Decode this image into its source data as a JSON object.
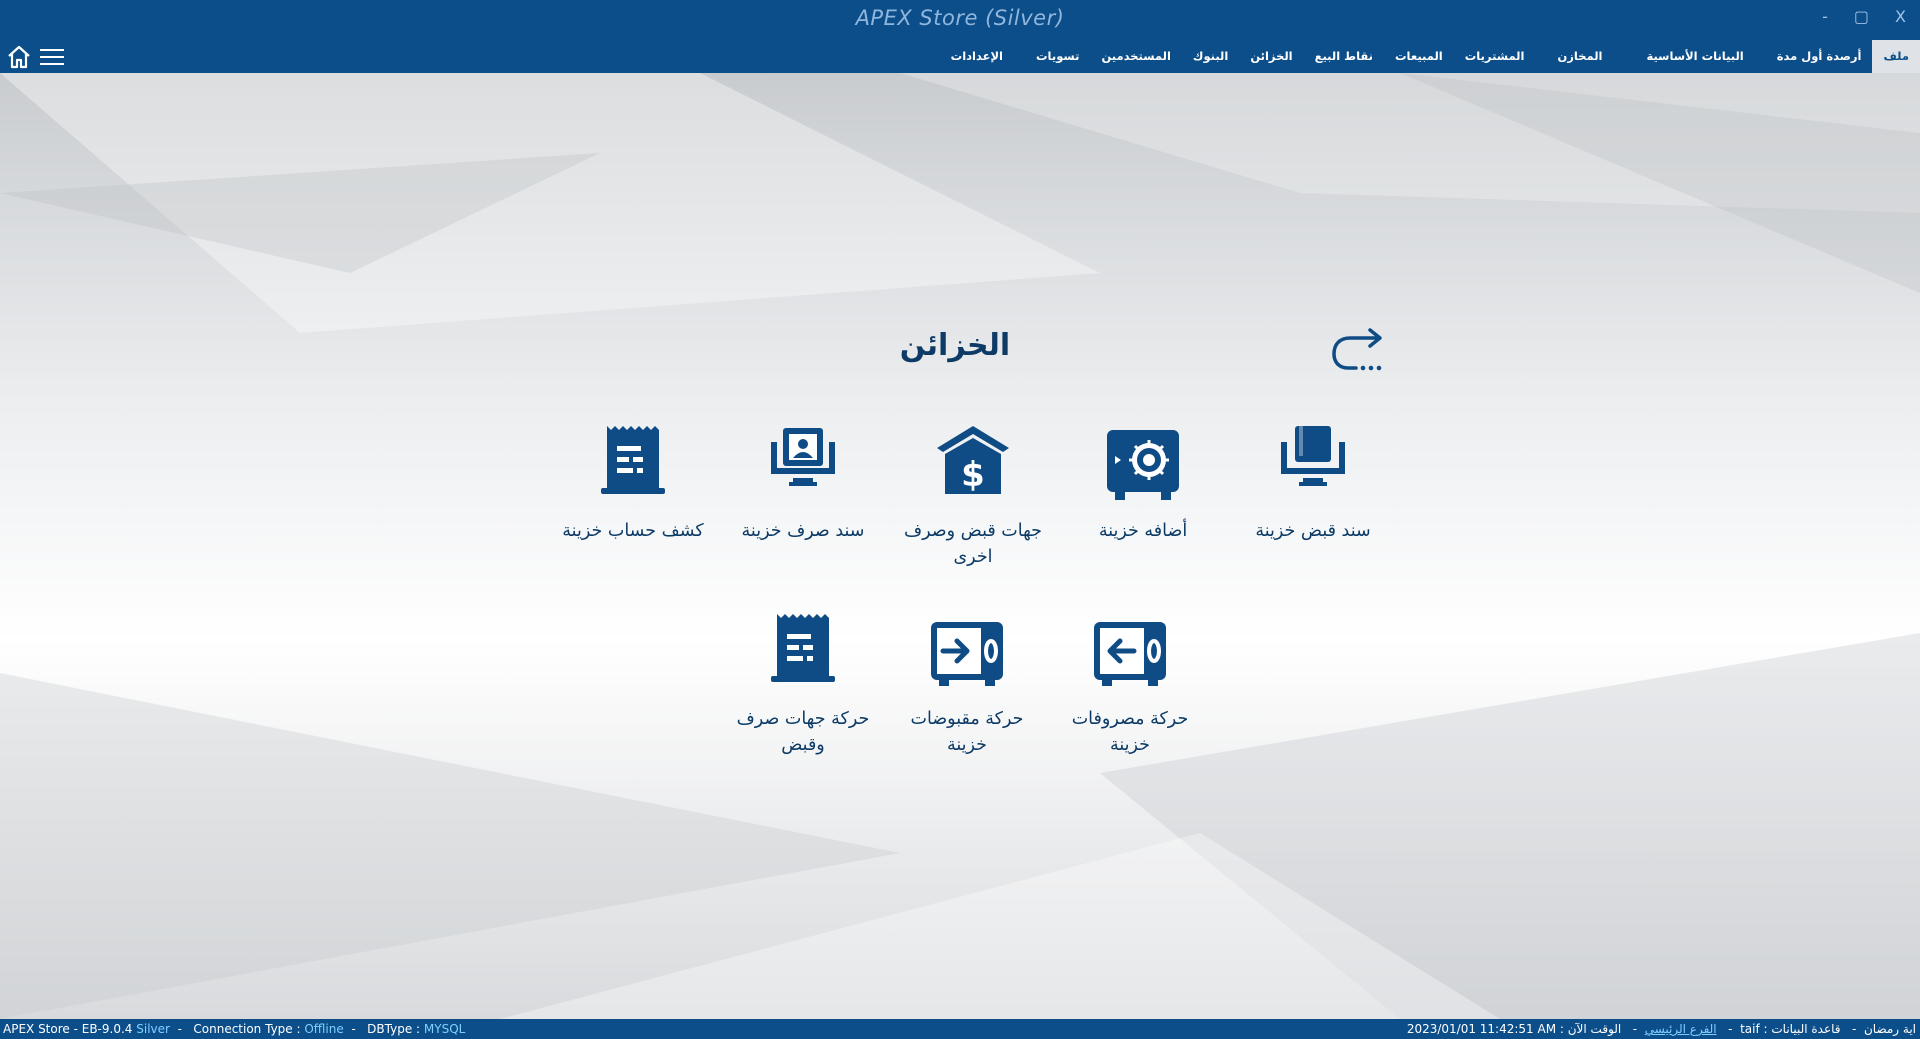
{
  "window": {
    "title": "APEX Store (Silver)",
    "minimize": "-",
    "maximize": "▢",
    "close": "X"
  },
  "menu": [
    {
      "label": "ملف",
      "active": true
    },
    {
      "label": "أرصدة أول مدة"
    },
    {
      "label": "البيانات الأساسية"
    },
    {
      "label": "المخازن"
    },
    {
      "label": "المشتريات"
    },
    {
      "label": "المبيعات"
    },
    {
      "label": "نقاط البيع"
    },
    {
      "label": "الخزائن"
    },
    {
      "label": "البنوك"
    },
    {
      "label": "المستخدمين"
    },
    {
      "label": "تسويات"
    },
    {
      "label": "الإعدادات"
    }
  ],
  "section": {
    "title": "الخزائن",
    "back_icon": "return-arrow-icon"
  },
  "tiles": [
    {
      "label": "سند قبض خزينة",
      "icon": "receipt-voucher-icon"
    },
    {
      "label": "أضافه خزينة",
      "icon": "safe-icon"
    },
    {
      "label": "جهات قبض وصرف اخرى",
      "icon": "bank-dollar-icon"
    },
    {
      "label": "سند صرف خزينة",
      "icon": "payment-voucher-icon"
    },
    {
      "label": "كشف حساب خزينة",
      "icon": "statement-icon"
    },
    {
      "label": "حركة مصروفات خزينة",
      "icon": "safe-out-icon"
    },
    {
      "label": "حركة مقبوضات خزينة",
      "icon": "safe-in-icon"
    },
    {
      "label": "حركة جهات صرف وقبض",
      "icon": "document-list-icon"
    }
  ],
  "status": {
    "app": "APEX Store - EB-9.0.4",
    "edition": "Silver",
    "conn_label": "Connection Type :",
    "conn_value": "Offline",
    "db_label": "DBType :",
    "db_value": "MYSQL",
    "user": "اية رمضان",
    "db_name_label": "قاعدة البيانات :",
    "db_name": "taif",
    "branch": "الفرع الرئيسي",
    "time_label": "الوقت الآن :",
    "datetime": "2023/01/01 11:42:51 AM"
  },
  "colors": {
    "primary": "#0c4e8a",
    "icon": "#0f4c85",
    "text": "#0d3b66",
    "accent": "#7fd0ff"
  }
}
